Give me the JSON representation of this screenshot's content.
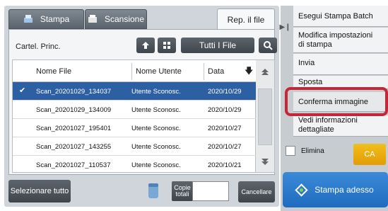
{
  "tabs": {
    "stampa": "Stampa",
    "scansione": "Scansione",
    "rep_il_file": "Rep. il file"
  },
  "toolbar": {
    "folder": "Cartel. Princ.",
    "all_files": "Tutti I File"
  },
  "table": {
    "headers": {
      "file_name": "Nome File",
      "user_name": "Nome Utente",
      "date": "Data"
    },
    "rows": [
      {
        "file": "Scan_20201029_134037",
        "user": "Utente Sconosc.",
        "date": "2020/10/29",
        "selected": true
      },
      {
        "file": "Scan_20201029_134009",
        "user": "Utente Sconosc.",
        "date": "2020/10/29",
        "selected": false
      },
      {
        "file": "Scan_20201027_195401",
        "user": "Utente Sconosc.",
        "date": "2020/10/27",
        "selected": false
      },
      {
        "file": "Scan_20201027_143255",
        "user": "Utente Sconosc.",
        "date": "2020/10/27",
        "selected": false
      },
      {
        "file": "Scan_20201027_110537",
        "user": "Utente Sconosc.",
        "date": "2020/10/21",
        "selected": false
      }
    ]
  },
  "bottom": {
    "select_all": "Selezionare tutto",
    "copies_label_1": "Copie",
    "copies_label_2": "totali",
    "copies_value": "",
    "cancel": "Cancellare"
  },
  "right_panel": {
    "items": [
      {
        "line1": "Esegui Stampa Batch",
        "line2": ""
      },
      {
        "line1": "Modifica impostazioni",
        "line2": "di stampa"
      },
      {
        "line1": "Invia",
        "line2": ""
      },
      {
        "line1": "Sposta",
        "line2": ""
      },
      {
        "line1": "Conferma immagine",
        "line2": ""
      },
      {
        "line1": "Vedi informazioni",
        "line2": "dettagliate"
      }
    ],
    "elimina": "Elimina",
    "ca": "CA",
    "stampa_adesso": "Stampa adesso"
  },
  "colors": {
    "selected_row": "#2d5fa3",
    "highlight": "#c62736",
    "ca_button": "#e49b06",
    "primary_button": "#1f6bc0"
  }
}
